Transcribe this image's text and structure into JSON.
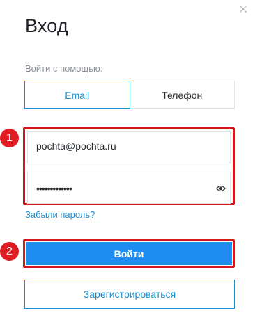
{
  "dialog": {
    "title": "Вход",
    "login_with_label": "Войти с помощью:"
  },
  "tabs": [
    {
      "label": "Email",
      "active": true
    },
    {
      "label": "Телефон",
      "active": false
    }
  ],
  "markers": {
    "fields": "1",
    "login": "2"
  },
  "form": {
    "email_value": "pochta@pochta.ru",
    "password_masked": "•••••••••••••",
    "forgot_link": "Забыли пароль?",
    "login_button": "Войти",
    "register_button": "Зарегистрироваться"
  },
  "colors": {
    "accent": "#1a8fd0",
    "primary_button": "#1e8cf0",
    "highlight_red": "#d2171f"
  },
  "icons": {
    "close": "close-icon",
    "show_password": "eye-icon"
  }
}
